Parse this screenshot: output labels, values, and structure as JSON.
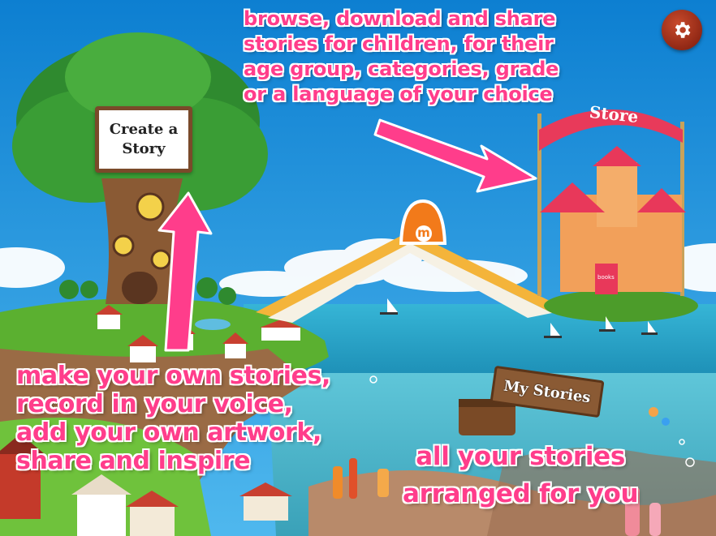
{
  "settings": {
    "icon": "gear-icon"
  },
  "store": {
    "banner_label": "Store",
    "description": "browse, download and share\nstories for children, for their\nage group, categories, grade\nor a language of your choice",
    "door_label": "books"
  },
  "create_story": {
    "sign_label": "Create a\nStory",
    "description": "make your own stories,\nrecord in your voice,\nadd your own artwork,\nshare and inspire"
  },
  "my_stories": {
    "sign_label": "My Stories",
    "description": "all your stories\narranged for you"
  },
  "book_logo": "m",
  "colors": {
    "accent_pink": "#ff3d8b",
    "sky": "#1a8fd8",
    "sea": "#2fa8c8",
    "grass": "#5cb030",
    "settings_button": "#a5311a"
  }
}
